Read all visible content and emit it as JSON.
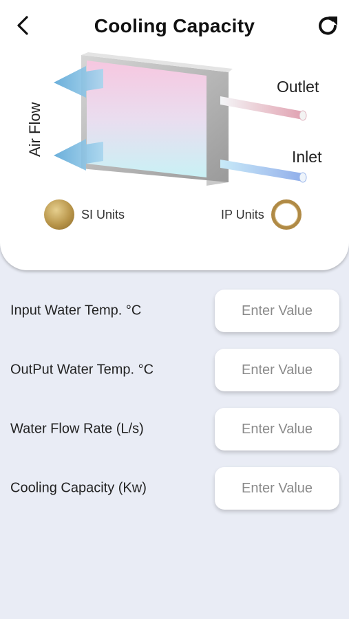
{
  "header": {
    "title": "Cooling Capacity"
  },
  "diagram": {
    "airflow_label": "Air Flow",
    "outlet_label": "Outlet",
    "inlet_label": "Inlet"
  },
  "units": {
    "si_label": "SI Units",
    "ip_label": "IP Units",
    "selected": "SI Units"
  },
  "form": {
    "rows": [
      {
        "label": "Input Water Temp. °C",
        "placeholder": "Enter Value",
        "value": ""
      },
      {
        "label": "OutPut Water Temp. °C",
        "placeholder": "Enter Value",
        "value": ""
      },
      {
        "label": "Water Flow Rate (L/s)",
        "placeholder": "Enter Value",
        "value": ""
      },
      {
        "label": "Cooling Capacity (Kw)",
        "placeholder": "Enter Value",
        "value": ""
      }
    ]
  },
  "colors": {
    "background": "#e9ecf5",
    "card": "#ffffff",
    "gold": "#b08a45"
  }
}
